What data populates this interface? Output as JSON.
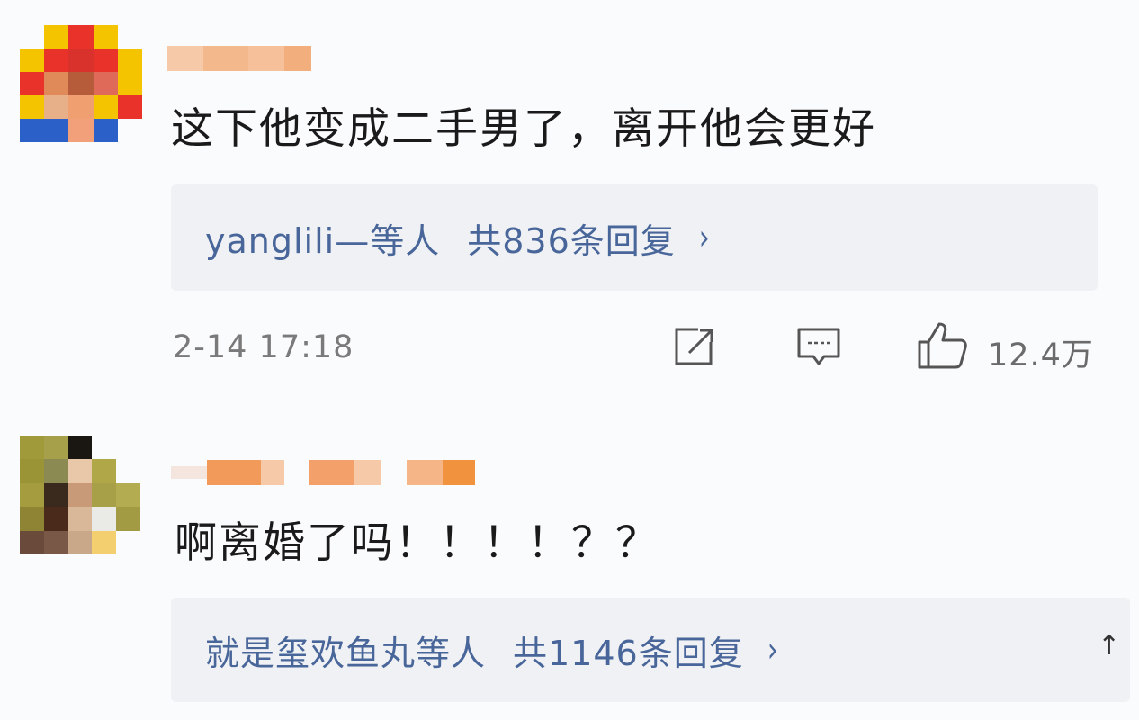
{
  "comments": [
    {
      "text": "这下他变成二手男了，离开他会更好",
      "reply_users": "yanglili—等人",
      "reply_count": "共836条回复",
      "timestamp": "2-14 17:18",
      "like_count": "12.4万"
    },
    {
      "text": "啊离婚了吗！！！！？？",
      "reply_users": "就是玺欢鱼丸等人",
      "reply_count": "共1146条回复"
    }
  ],
  "icons": {
    "chevron": "›",
    "scroll_top": "↑",
    "share": "share-icon",
    "comment": "comment-icon",
    "like": "thumbs-up-icon"
  },
  "colors": {
    "reply_link": "#49669a",
    "reply_bg": "#f0f1f4",
    "meta_gray": "#7a7a7a"
  }
}
